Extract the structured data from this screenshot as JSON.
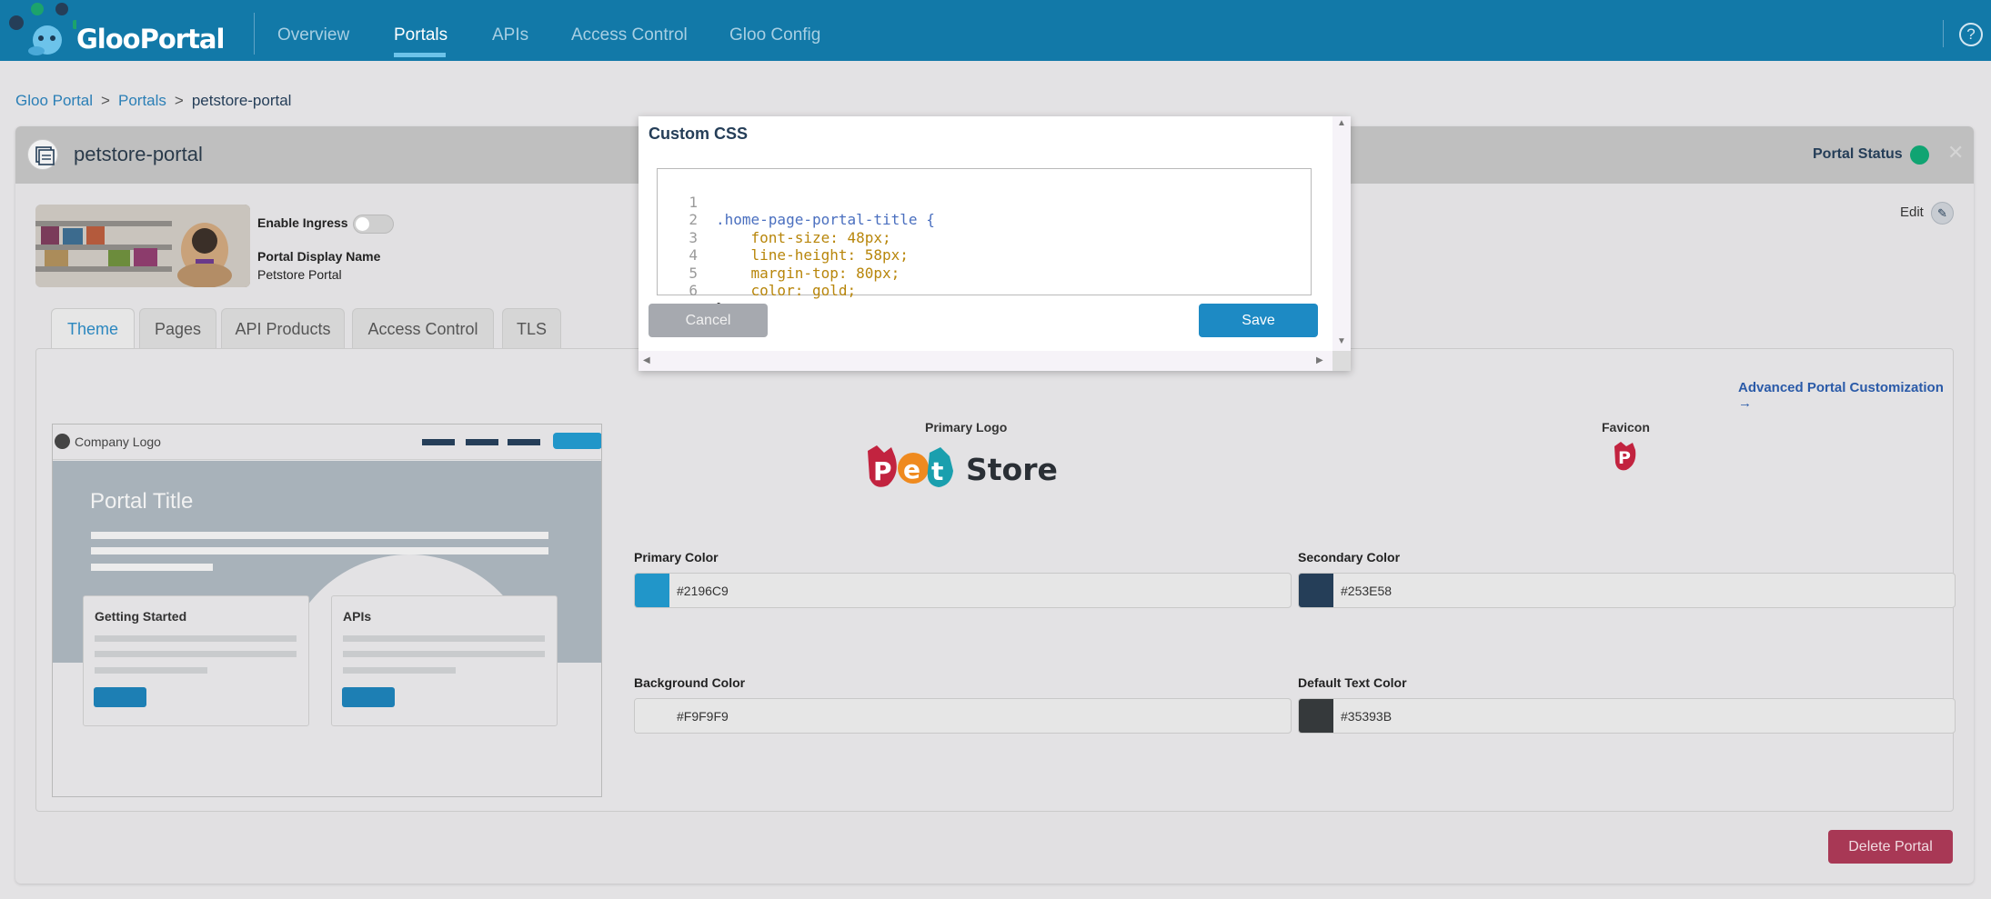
{
  "app": {
    "logo_text": "GlooPortal"
  },
  "nav": {
    "items": [
      {
        "label": "Overview",
        "active": false
      },
      {
        "label": "Portals",
        "active": true
      },
      {
        "label": "APIs",
        "active": false
      },
      {
        "label": "Access Control",
        "active": false
      },
      {
        "label": "Gloo Config",
        "active": false
      }
    ],
    "help_icon": "question-circle-icon",
    "help_glyph": "?"
  },
  "breadcrumb": {
    "items": [
      "Gloo Portal",
      "Portals",
      "petstore-portal"
    ],
    "separator": ">"
  },
  "portal": {
    "name": "petstore-portal",
    "status_label": "Portal Status",
    "status_color": "#10a472",
    "close_glyph": "✕",
    "enable_ingress_label": "Enable Ingress",
    "enable_ingress": false,
    "display_name_label": "Portal Display Name",
    "display_name": "Petstore Portal",
    "edit_label": "Edit",
    "edit_glyph": "✎",
    "delete_label": "Delete Portal"
  },
  "tabs": [
    {
      "label": "Theme",
      "active": true
    },
    {
      "label": "Pages",
      "active": false
    },
    {
      "label": "API Products",
      "active": false
    },
    {
      "label": "Access Control",
      "active": false
    },
    {
      "label": "TLS",
      "active": false
    }
  ],
  "theme": {
    "advanced_link": "Advanced Portal Customization →",
    "preview": {
      "company_logo": "Company Logo",
      "portal_title": "Portal Title",
      "card1_title": "Getting Started",
      "card2_title": "APIs"
    },
    "primary_logo_label": "Primary Logo",
    "primary_logo_text": "PetStore",
    "favicon_label": "Favicon",
    "colors": {
      "primary": {
        "label": "Primary Color",
        "value": "#2196C9"
      },
      "secondary": {
        "label": "Secondary Color",
        "value": "#253E58"
      },
      "background": {
        "label": "Background Color",
        "value": "#F9F9F9"
      },
      "text": {
        "label": "Default Text Color",
        "value": "#35393B"
      }
    }
  },
  "modal": {
    "title": "Custom CSS",
    "code_lines": [
      {
        "num": "1",
        "text": ".home-page-portal-title {"
      },
      {
        "num": "2",
        "text": "    font-size: 48px;"
      },
      {
        "num": "3",
        "text": "    line-height: 58px;"
      },
      {
        "num": "4",
        "text": "    margin-top: 80px;"
      },
      {
        "num": "5",
        "text": "    color: gold;"
      },
      {
        "num": "6",
        "text": "}"
      }
    ],
    "cancel_label": "Cancel",
    "save_label": "Save"
  }
}
